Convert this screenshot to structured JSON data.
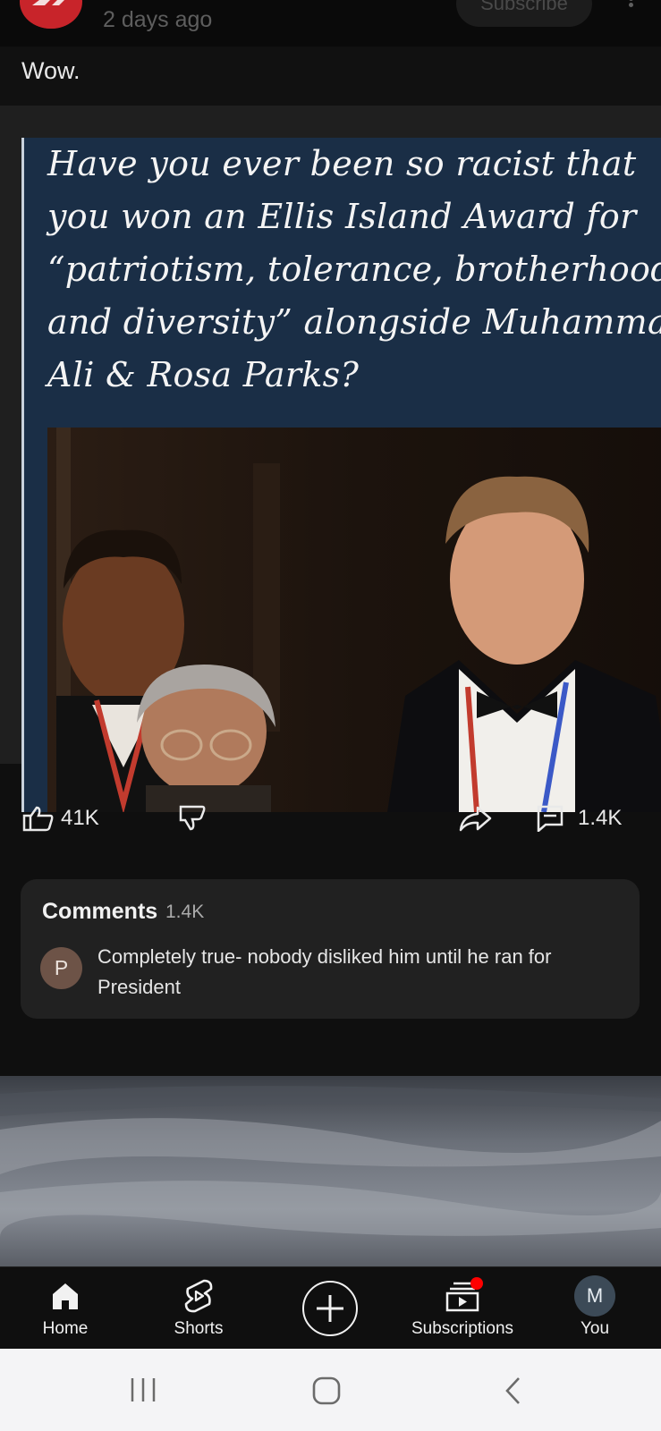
{
  "post": {
    "time_ago": "2 days ago",
    "subscribe_label": "Subscribe",
    "text": "Wow."
  },
  "meme": {
    "lines": [
      "Have you ever been so racist that",
      "you won an Ellis Island Award for",
      "“patriotism, tolerance, brotherhood",
      "and diversity” alongside Muhammad",
      "Ali & Rosa Parks?"
    ]
  },
  "actions": {
    "like_count": "41K",
    "comment_count": "1.4K"
  },
  "comments": {
    "title": "Comments",
    "count": "1.4K",
    "top_comment_avatar_letter": "P",
    "top_comment_text": "Completely true- nobody disliked him until he ran for President"
  },
  "bottom_nav": {
    "items": [
      {
        "label": "Home",
        "icon": "home-icon"
      },
      {
        "label": "Shorts",
        "icon": "shorts-icon"
      },
      {
        "label": "",
        "icon": "create-icon"
      },
      {
        "label": "Subscriptions",
        "icon": "subscriptions-icon"
      },
      {
        "label": "You",
        "icon": "avatar"
      }
    ],
    "you_avatar_letter": "M"
  },
  "colors": {
    "background": "#0f0f0f",
    "card": "#212121",
    "meme_background": "#1a2e46",
    "notification_dot": "#ff0000"
  }
}
